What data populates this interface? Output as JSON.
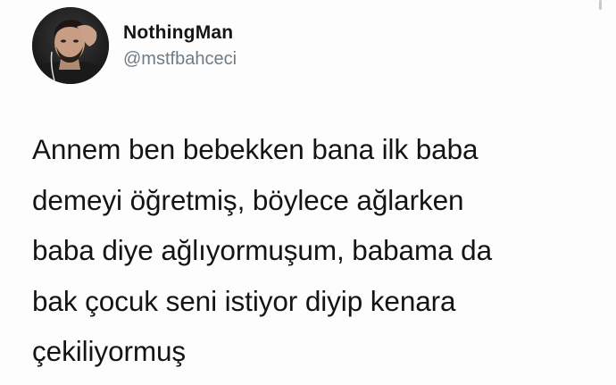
{
  "user": {
    "display_name": "NothingMan",
    "handle": "@mstfbahceci"
  },
  "tweet": {
    "lines": [
      "Annem ben bebekken bana ilk baba",
      "demeyi öğretmiş, böylece ağlarken",
      "baba diye ağlıyormuşum, babama da",
      "bak çocuk seni istiyor diyip kenara",
      "çekiliyormuş"
    ]
  },
  "colors": {
    "background": "#fdfdfd",
    "text": "#141414",
    "handle": "#6f7b85"
  },
  "icons": {
    "avatar": "profile-photo"
  }
}
